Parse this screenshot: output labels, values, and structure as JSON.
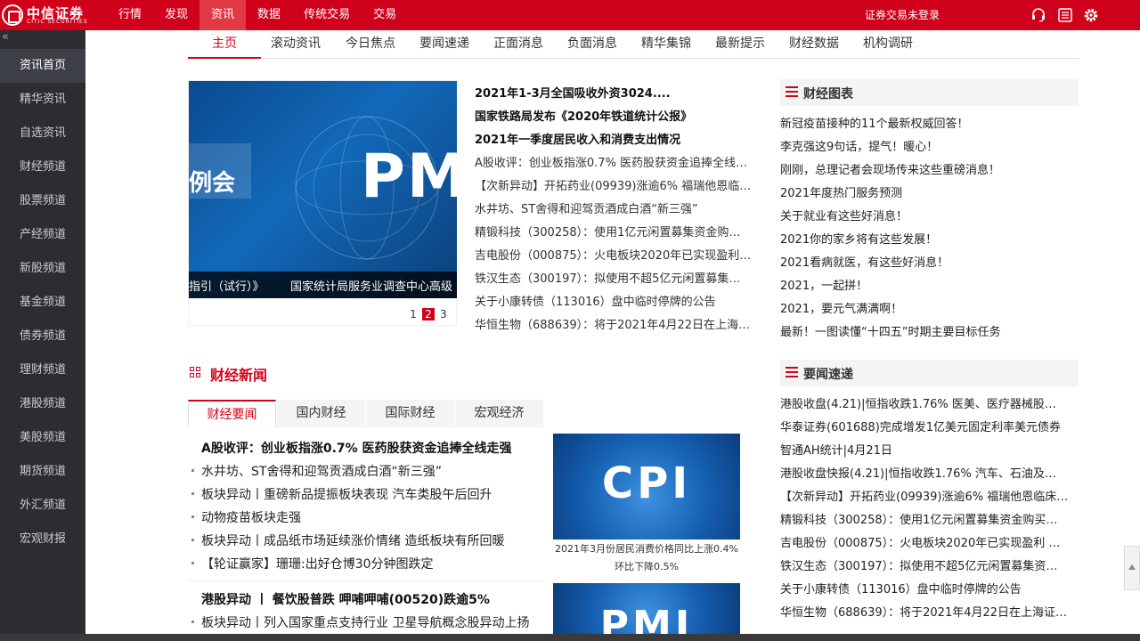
{
  "brand": {
    "name": "中信证券",
    "en": "CITIC SECURITIES"
  },
  "topnav": [
    {
      "label": "行情"
    },
    {
      "label": "发现"
    },
    {
      "label": "资讯",
      "active": true
    },
    {
      "label": "数据"
    },
    {
      "label": "传统交易"
    },
    {
      "label": "交易"
    }
  ],
  "login_status": "证券交易未登录",
  "tool_icons": [
    "headset-icon",
    "news-icon",
    "gear-icon"
  ],
  "sidebar": {
    "collapse_label": "«",
    "items": [
      "资讯首页",
      "精华资讯",
      "自选资讯",
      "财经频道",
      "股票频道",
      "产经频道",
      "新股频道",
      "基金频道",
      "债券频道",
      "理财频道",
      "港股频道",
      "美股频道",
      "期货频道",
      "外汇频道",
      "宏观财报"
    ]
  },
  "subnav": [
    "主页",
    "滚动资讯",
    "今日焦点",
    "要闻速递",
    "正面消息",
    "负面消息",
    "精华集锦",
    "最新提示",
    "财经数据",
    "机构调研"
  ],
  "slider": {
    "big_text": "PM",
    "small_text": "例会",
    "caption_left": "指引（试行）》",
    "caption_right": "国家统计局服务业调查中心高级",
    "pages": [
      "1",
      "2",
      "3"
    ],
    "active_page": 2
  },
  "headlines": [
    {
      "text": "2021年1-3月全国吸收外资3024....",
      "bold": true
    },
    {
      "text": "国家铁路局发布《2020年铁道统计公报》",
      "bold": true
    },
    {
      "text": "2021年一季度居民收入和消费支出情况",
      "bold": true
    },
    {
      "text": "A股收评：创业板指涨0.7% 医药股获资金追捧全线…",
      "bold": false
    },
    {
      "text": "【次新异动】开拓药业(09939)涨逾6% 福瑞他恩临…",
      "bold": false
    },
    {
      "text": "水井坊、ST舍得和迎驾贡酒成白酒“新三强”",
      "bold": false
    },
    {
      "text": "精锻科技（300258）：使用1亿元闲置募集资金购…",
      "bold": false
    },
    {
      "text": "吉电股份（000875）：火电板块2020年已实现盈利…",
      "bold": false
    },
    {
      "text": "铁汉生态（300197）：拟使用不超5亿元闲置募集…",
      "bold": false
    },
    {
      "text": "关于小康转债（113016）盘中临时停牌的公告",
      "bold": false
    },
    {
      "text": "华恒生物（688639）：将于2021年4月22日在上海…",
      "bold": false
    }
  ],
  "finance_charts": {
    "title": "财经图表",
    "items": [
      "新冠疫苗接种的11个最新权威回答！",
      "李克强这9句话，提气！暖心！",
      "刚刚，总理记者会现场传来这些重磅消息！",
      "2021年度热门服务预测",
      "关于就业有这些好消息！",
      "2021你的家乡将有这些发展！",
      "2021看病就医，有这些好消息！",
      "2021，一起拼！",
      "2021，要元气满满啊！",
      "最新！一图读懂“十四五”时期主要目标任务"
    ]
  },
  "quick_news": {
    "title": "要闻速递",
    "items": [
      "港股收盘(4.21)|恒指收跌1.76% 医美、医疗器械股…",
      "华泰证券(601688)完成增发1亿美元固定利率美元债券",
      "智通AH统计|4月21日",
      "港股收盘快报(4.21)|恒指收跌1.76% 汽车、石油及…",
      "【次新异动】开拓药业(09939)涨逾6% 福瑞他恩临床…",
      "精锻科技（300258）：使用1亿元闲置募集资金购买…",
      "吉电股份（000875）：火电板块2020年已实现盈利 …",
      "铁汉生态（300197）：拟使用不超5亿元闲置募集资…",
      "关于小康转债（113016）盘中临时停牌的公告",
      "华恒生物（688639）：将于2021年4月22日在上海证…"
    ]
  },
  "finance_news": {
    "title": "财经新闻",
    "tabs": [
      "财经要闻",
      "国内财经",
      "国际财经",
      "宏观经济"
    ],
    "active_tab": 0,
    "group1_head": "A股收评：创业板指涨0.7% 医药股获资金追捧全线走强",
    "group1_items": [
      "水井坊、ST舍得和迎驾贡酒成白酒“新三强”",
      "板块异动丨重磅新品提振板块表现 汽车类股午后回升",
      "动物疫苗板块走强",
      "板块异动丨成品纸市场延续涨价情绪 造纸板块有所回暖",
      "【轮证赢家】珊珊:出好仓博30分钟图跌定"
    ],
    "group2_head": "港股异动 丨 餐饮股普跌 呷哺呷哺(00520)跌逾5%",
    "group2_items": [
      "板块异动丨列入国家重点支持行业 卫星导航概念股异动上扬"
    ],
    "thumb1_text": "CPI",
    "thumb1_caption": "2021年3月份居民消费价格同比上涨0.4% 环比下降0.5%",
    "thumb2_text": "PMI"
  }
}
